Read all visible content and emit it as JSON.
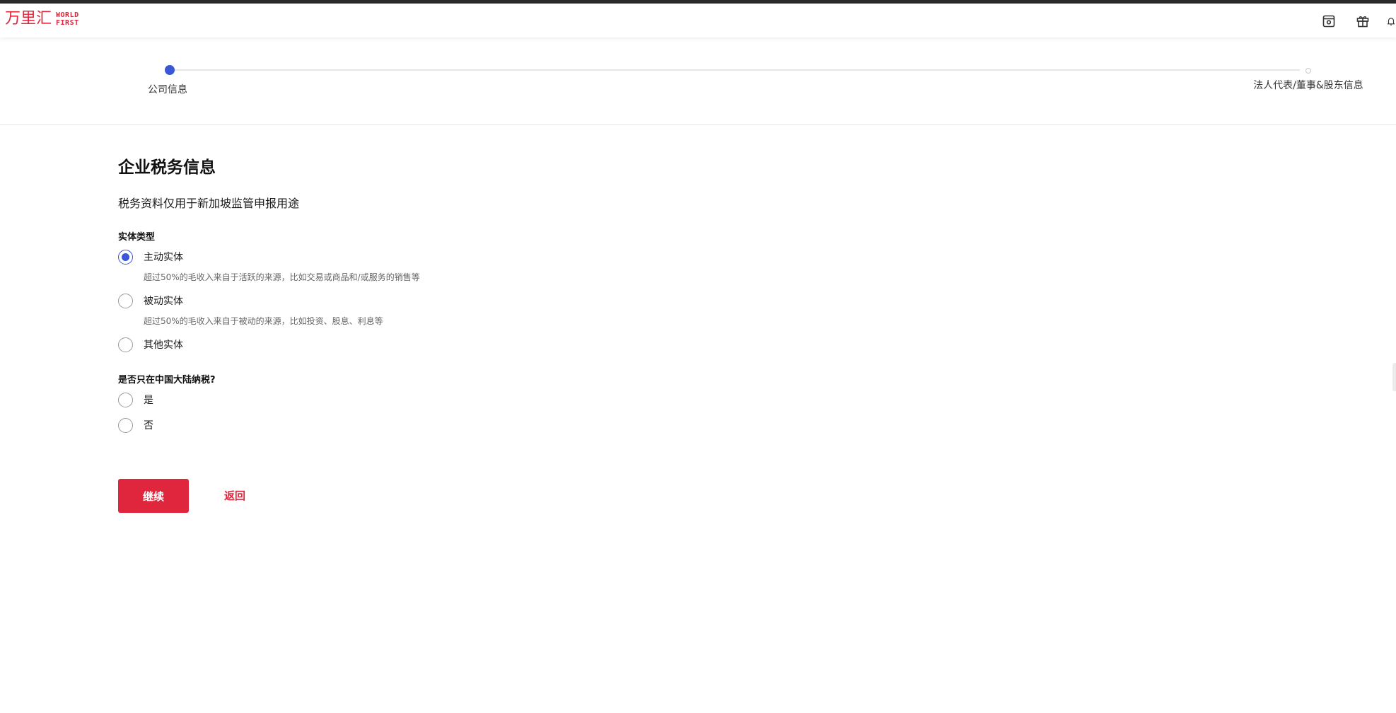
{
  "brand": {
    "logo_cn": "万里汇",
    "logo_en_line1": "WORLD",
    "logo_en_line2": "FIRST",
    "color": "#e0263d"
  },
  "header": {
    "icons": [
      "wallet-icon",
      "gift-icon",
      "bell-icon"
    ]
  },
  "stepper": {
    "steps": [
      {
        "label": "公司信息",
        "state": "active"
      },
      {
        "label": "法人代表/董事&股东信息",
        "state": "inactive"
      }
    ],
    "active_color": "#3a57d6"
  },
  "form": {
    "title": "企业税务信息",
    "subtitle": "税务资料仅用于新加坡监管申报用途",
    "entity_type": {
      "label": "实体类型",
      "options": [
        {
          "label": "主动实体",
          "description": "超过50%的毛收入来自于活跃的来源，比如交易或商品和/或服务的销售等",
          "checked": true
        },
        {
          "label": "被动实体",
          "description": "超过50%的毛收入来自于被动的来源，比如投资、股息、利息等",
          "checked": false
        },
        {
          "label": "其他实体",
          "description": "",
          "checked": false
        }
      ]
    },
    "mainland_tax": {
      "label": "是否只在中国大陆纳税?",
      "options": [
        {
          "label": "是",
          "checked": false
        },
        {
          "label": "否",
          "checked": false
        }
      ]
    }
  },
  "actions": {
    "continue_label": "继续",
    "back_label": "返回"
  }
}
